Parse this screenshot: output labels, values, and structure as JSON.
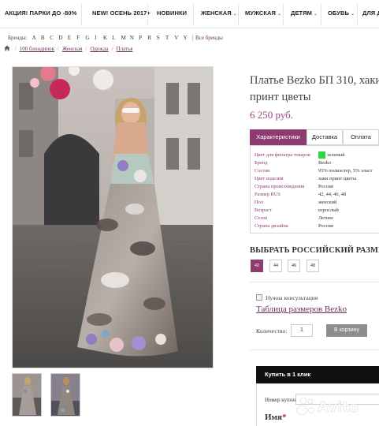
{
  "nav": {
    "items": [
      {
        "label": "АКЦИЯ! ПАРКИ ДО -80%",
        "chevron": false
      },
      {
        "label": "NEW! ОСЕНЬ 2017+",
        "chevron": false
      },
      {
        "label": "НОВИНКИ",
        "chevron": false
      },
      {
        "label": "ЖЕНСКАЯ",
        "chevron": true
      },
      {
        "label": "МУЖСКАЯ",
        "chevron": true
      },
      {
        "label": "ДЕТЯМ",
        "chevron": true
      },
      {
        "label": "ОБУВЬ",
        "chevron": true
      },
      {
        "label": "ДЛЯ Д",
        "chevron": false
      }
    ]
  },
  "brands": {
    "label": "Бренды:",
    "letters": [
      "A",
      "B",
      "C",
      "D",
      "E",
      "F",
      "G",
      "J",
      "K",
      "L",
      "M",
      "N",
      "P",
      "R",
      "S",
      "T",
      "V",
      "Y"
    ],
    "all_label": "Все бренды"
  },
  "breadcrumb": {
    "items": [
      "100 блондинок",
      "Женская",
      "Одежда",
      "Платья"
    ],
    "separator": "/"
  },
  "product": {
    "title": "Платье Bezko БП 310, хаки принт цветы",
    "price": "6 250 руб."
  },
  "tabs": [
    {
      "label": "Характеристики",
      "active": true
    },
    {
      "label": "Доставка",
      "active": false
    },
    {
      "label": "Оплата",
      "active": false
    }
  ],
  "specs": [
    {
      "key": "Цвет для фильтра товаров",
      "value": "зеленый",
      "swatch": "#2ed63e"
    },
    {
      "key": "Бренд",
      "value": "Bezko"
    },
    {
      "key": "Состав",
      "value": "95% полиэстер, 5% эласт"
    },
    {
      "key": "Цвет изделия",
      "value": "хаки принт цветы"
    },
    {
      "key": "Страна происхождения",
      "value": "Россия"
    },
    {
      "key": "Размер RUS",
      "value": "42, 44, 46, 48"
    },
    {
      "key": "Пол",
      "value": "женский"
    },
    {
      "key": "Возраст",
      "value": "взрослый"
    },
    {
      "key": "Сезон",
      "value": "Летнее"
    },
    {
      "key": "Страна дизайна",
      "value": "Россия"
    }
  ],
  "sizes": {
    "title": "ВЫБРАТЬ РОССИЙСКИЙ РАЗМЕР",
    "options": [
      {
        "label": "42",
        "active": true
      },
      {
        "label": "44",
        "active": false
      },
      {
        "label": "46",
        "active": false
      },
      {
        "label": "48",
        "active": false
      }
    ]
  },
  "consult_label": "Нужна консультация",
  "size_table_link": "Таблица размеров Bezko",
  "quantity": {
    "label": "Количество:",
    "value": "1"
  },
  "cart_button": "В корзину",
  "one_click": {
    "title": "Купить в 1 клик",
    "coupon_label": "Номер купона:",
    "name_label": "Имя",
    "required_mark": "*"
  },
  "colors": {
    "accent": "#8e3b72",
    "link": "#6a2f5c",
    "price": "#a0457f"
  }
}
